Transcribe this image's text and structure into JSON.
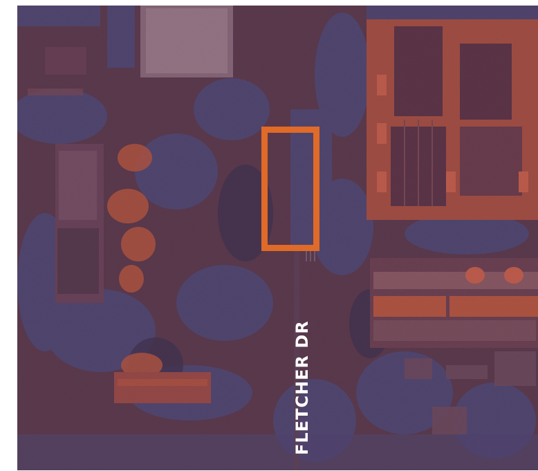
{
  "map": {
    "street_label": "FLETCHER DR",
    "colors": {
      "base": "#5a3a4a",
      "road_blue": "#4e4a78",
      "building_orange": "#b8573e",
      "roof_dark": "#5c3445",
      "highlight": "#e06a28",
      "label": "#ffffff"
    }
  }
}
